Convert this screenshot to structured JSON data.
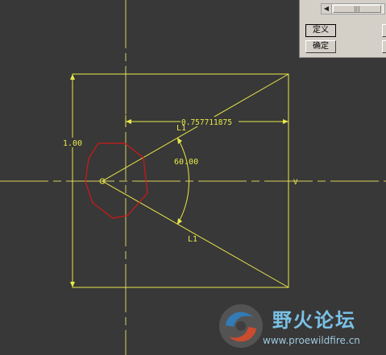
{
  "dialog": {
    "scroll_thumb_glyph": "|||",
    "scroll_left_glyph": "◀",
    "define_label": "定义",
    "ok_label": "确定"
  },
  "sketch": {
    "dim_height": "1.00",
    "dim_width": "0.757711875",
    "dim_angle": "60.00",
    "label_top": "L1",
    "label_bottom": "L1",
    "label_v": "V"
  },
  "watermark": {
    "title": "野火论坛",
    "url": "www.proewildfire.cn"
  },
  "colors": {
    "background": "#383838",
    "sketch_yellow": "#e8e84a",
    "profile_red": "#d01818",
    "centerline": "#d8d060",
    "dialog_gray": "#d4d0c8"
  }
}
